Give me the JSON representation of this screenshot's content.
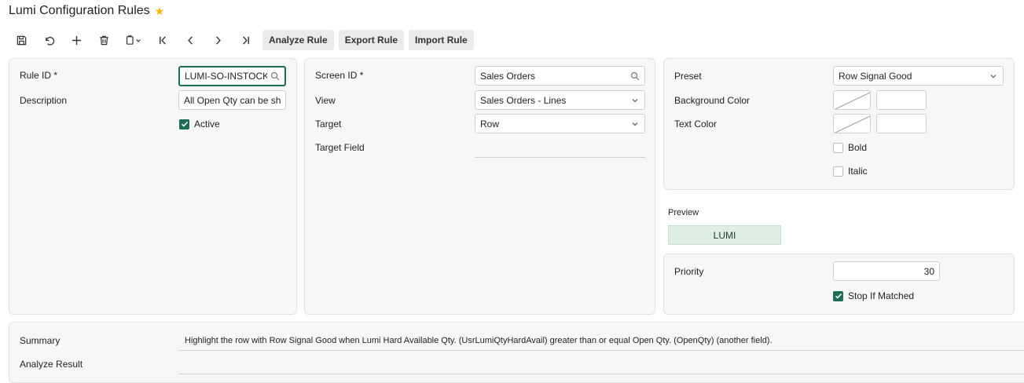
{
  "header": {
    "title": "Lumi Configuration Rules"
  },
  "toolbar": {
    "analyze_label": "Analyze Rule",
    "export_label": "Export Rule",
    "import_label": "Import Rule"
  },
  "rule": {
    "rule_id_label": "Rule ID",
    "rule_id_value": "LUMI-SO-INSTOCK_",
    "description_label": "Description",
    "description_value": "All Open Qty can be shipped",
    "active_label": "Active"
  },
  "screen": {
    "screen_id_label": "Screen ID",
    "screen_id_value": "Sales Orders",
    "view_label": "View",
    "view_value": "Sales Orders - Lines",
    "target_label": "Target",
    "target_value": "Row",
    "target_field_label": "Target Field"
  },
  "style": {
    "preset_label": "Preset",
    "preset_value": "Row Signal Good",
    "background_color_label": "Background Color",
    "text_color_label": "Text Color",
    "bold_label": "Bold",
    "italic_label": "Italic"
  },
  "preview": {
    "label": "Preview",
    "text": "LUMI",
    "background": "#dcefe2",
    "text_color": "#1f3b2c"
  },
  "priority": {
    "label": "Priority",
    "value": "30",
    "stop_label": "Stop If Matched"
  },
  "summary": {
    "label": "Summary",
    "text": "Highlight the row with Row Signal Good when Lumi Hard Available Qty. (UsrLumiQtyHardAvail) greater than or equal Open Qty. (OpenQty) (another field).",
    "analyze_result_label": "Analyze Result"
  },
  "colors": {
    "accent": "#1f6b55",
    "star": "#f2b600"
  }
}
